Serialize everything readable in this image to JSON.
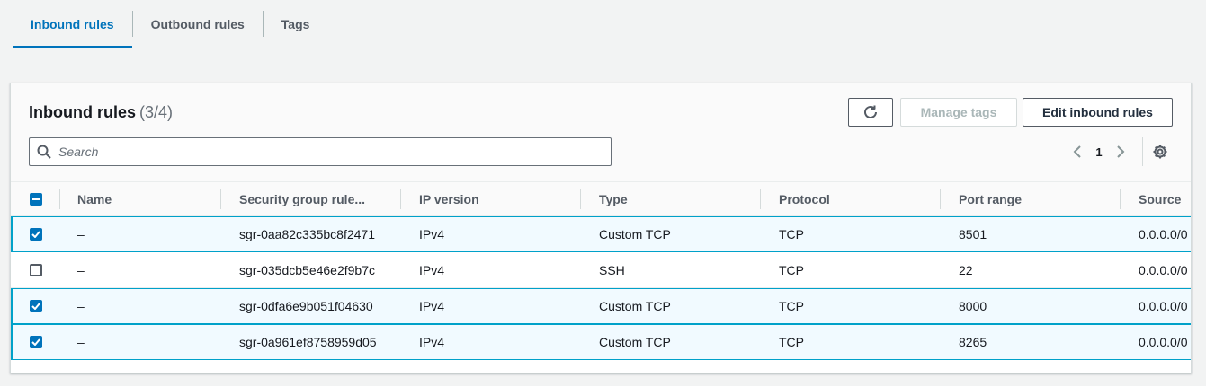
{
  "tabs": [
    {
      "label": "Inbound rules",
      "active": true
    },
    {
      "label": "Outbound rules",
      "active": false
    },
    {
      "label": "Tags",
      "active": false
    }
  ],
  "panel": {
    "title": "Inbound rules",
    "count": "(3/4)",
    "buttons": {
      "refresh_icon": "refresh-icon",
      "manage_tags": "Manage tags",
      "edit_inbound_rules": "Edit inbound rules"
    },
    "search_placeholder": "Search",
    "pagination": {
      "page": "1"
    }
  },
  "table": {
    "columns": [
      "Name",
      "Security group rule...",
      "IP version",
      "Type",
      "Protocol",
      "Port range",
      "Source"
    ],
    "rows": [
      {
        "selected": true,
        "name": "–",
        "rule_id": "sgr-0aa82c335bc8f2471",
        "ip_version": "IPv4",
        "type": "Custom TCP",
        "protocol": "TCP",
        "port_range": "8501",
        "source": "0.0.0.0/0"
      },
      {
        "selected": false,
        "name": "–",
        "rule_id": "sgr-035dcb5e46e2f9b7c",
        "ip_version": "IPv4",
        "type": "SSH",
        "protocol": "TCP",
        "port_range": "22",
        "source": "0.0.0.0/0"
      },
      {
        "selected": true,
        "name": "–",
        "rule_id": "sgr-0dfa6e9b051f04630",
        "ip_version": "IPv4",
        "type": "Custom TCP",
        "protocol": "TCP",
        "port_range": "8000",
        "source": "0.0.0.0/0"
      },
      {
        "selected": true,
        "name": "–",
        "rule_id": "sgr-0a961ef8758959d05",
        "ip_version": "IPv4",
        "type": "Custom TCP",
        "protocol": "TCP",
        "port_range": "8265",
        "source": "0.0.0.0/0"
      }
    ]
  },
  "colors": {
    "accent": "#0073bb",
    "selected_border": "#00a1c9",
    "selected_bg": "#f1faff"
  }
}
